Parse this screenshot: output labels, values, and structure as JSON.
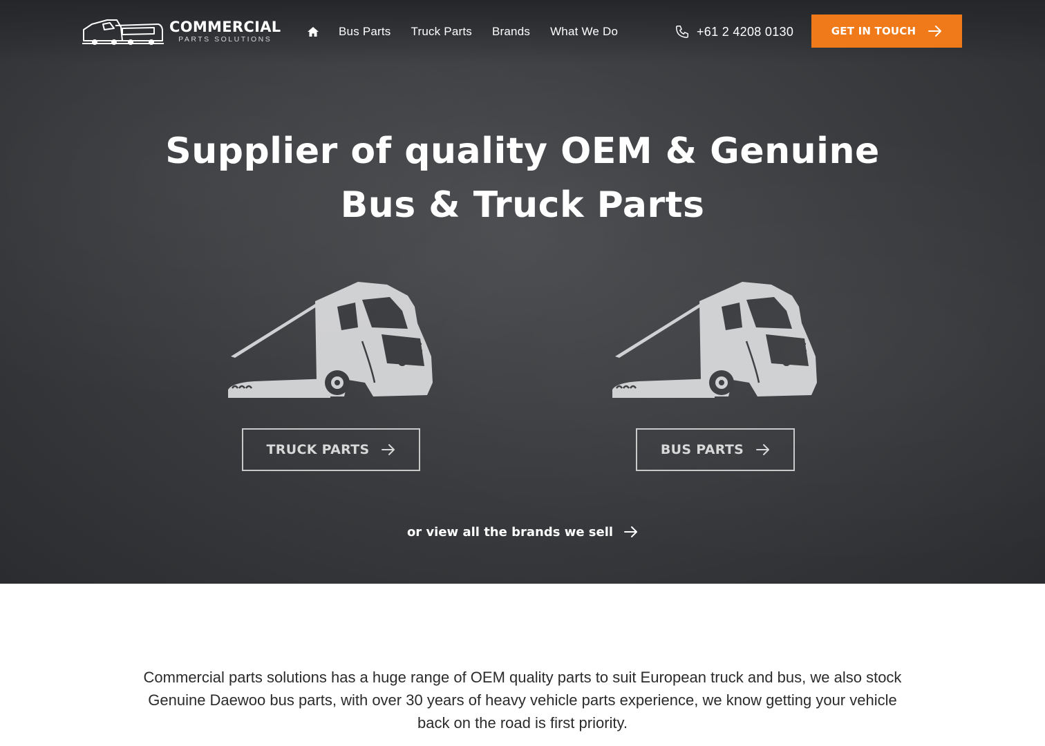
{
  "brand": {
    "title": "COMMERCIAL",
    "subtitle": "PARTS SOLUTIONS"
  },
  "nav": {
    "home_icon": "home-icon",
    "items": [
      {
        "label": "Bus Parts"
      },
      {
        "label": "Truck Parts"
      },
      {
        "label": "Brands"
      },
      {
        "label": "What We Do"
      }
    ],
    "phone": "+61 2 4208 0130",
    "phone_icon": "phone-icon",
    "cta_label": "GET IN TOUCH"
  },
  "hero": {
    "headline_line1": "Supplier of quality OEM & Genuine",
    "headline_line2": "Bus & Truck Parts",
    "truck_button": "TRUCK PARTS",
    "bus_button": "BUS PARTS",
    "brands_link": "or view all the brands we sell"
  },
  "intro": {
    "text": "Commercial parts solutions has a huge range of OEM quality parts to suit European truck and bus, we also stock Genuine Daewoo bus parts, with over 30 years of heavy vehicle parts experience, we know getting your vehicle back on the road is first priority."
  },
  "colors": {
    "accent": "#f07a1a",
    "hero_bg": "#3b3d40",
    "text_dark": "#2b2b2b"
  }
}
